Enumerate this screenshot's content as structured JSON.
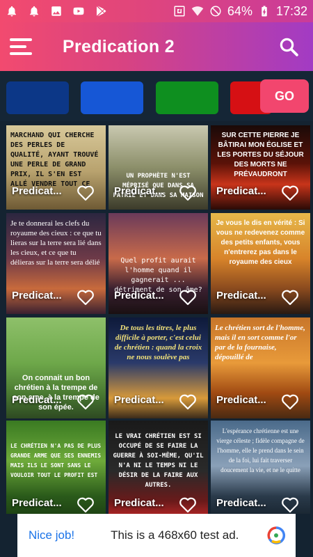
{
  "status_bar": {
    "battery": "64%",
    "time": "17:32",
    "left_icons": [
      "notification-bell-icon",
      "notification-bell-icon",
      "image-icon",
      "youtube-icon",
      "play-store-icon"
    ],
    "right_icons": [
      "nfc-icon",
      "wifi-icon",
      "do-not-disturb-icon",
      "battery-icon"
    ]
  },
  "app_bar": {
    "title": "Predication 2",
    "menu_icon": "menu-icon",
    "search_icon": "search-icon"
  },
  "color_picker": {
    "swatches": [
      "#0c3787",
      "#1657d6",
      "#0e8f1f",
      "#d61014"
    ],
    "go_label": "GO",
    "go_color": "#f2466e"
  },
  "grid": {
    "cards": [
      {
        "label": "Predicat...",
        "overlay": "MARCHAND QUI CHERCHE DES PERLES DE QUALITÉ, AYANT TROUVÉ UNE PERLE DE GRAND PRIX, IL S'EN EST ALLÉ VENDRE TOUT CE"
      },
      {
        "label": "Predicat...",
        "overlay": "UN PROPHÈTE N'EST MÉPRISÉ QUE DANS SA PATRIE ET DANS SA MAISON"
      },
      {
        "label": "Predicat...",
        "overlay": "SUR CETTE PIERRE JE BÂTIRAI MON ÉGLISE ET LES PORTES DU SÉJOUR DES MORTS NE PRÉVAUDRONT"
      },
      {
        "label": "Predicat...",
        "overlay": "Je te donnerai les clefs du royaume des cieux : ce que tu lieras sur la terre sera lié dans les cieux, et ce que tu délieras sur la terre sera délié"
      },
      {
        "label": "Predicat...",
        "overlay": "Quel profit aurait l'homme quand il gagnerait ... détriment de son âme?"
      },
      {
        "label": "Predicat...",
        "overlay": "Je vous le dis en vérité : Si vous ne redevenez comme des petits enfants, vous n'entrerez pas dans le royaume des cieux"
      },
      {
        "label": "Predicat...",
        "overlay": "On connait un bon chrétien à la trempe de son ame, à la trempe de son épée."
      },
      {
        "label": "Predicat...",
        "overlay": "De tous les titres, le plus difficile à porter, c'est celui de chrétien : quand la croix ne nous soulève pas"
      },
      {
        "label": "Predicat...",
        "overlay": "Le chrétien sort de l'homme, mais il en sort comme l'or par de la fournaise, dépouillé de"
      },
      {
        "label": "Predicat...",
        "overlay": "LE CHRÉTIEN N'A PAS DE PLUS GRANDE ARME QUE SES ENNEMIS MAIS ILS LE SONT SANS LE VOULOIR TOUT LE PROFIT EST"
      },
      {
        "label": "Predicat...",
        "overlay": "LE VRAI CHRÉTIEN EST SI OCCUPÉ DE SE FAIRE LA GUERRE À SOI-MÊME, QU'IL N'A NI LE TEMPS NI LE DÉSIR DE LA FAIRE AUX AUTRES."
      },
      {
        "label": "Predicat...",
        "overlay": "L'espérance chrétienne est une vierge céleste ; fidèle compagne de l'homme, elle le prend dans le sein de la foi, lui fait traverser doucement la vie, et ne le quitte"
      }
    ]
  },
  "ad": {
    "left_text": "Nice job!",
    "main_text": "This is a 468x60 test ad."
  }
}
